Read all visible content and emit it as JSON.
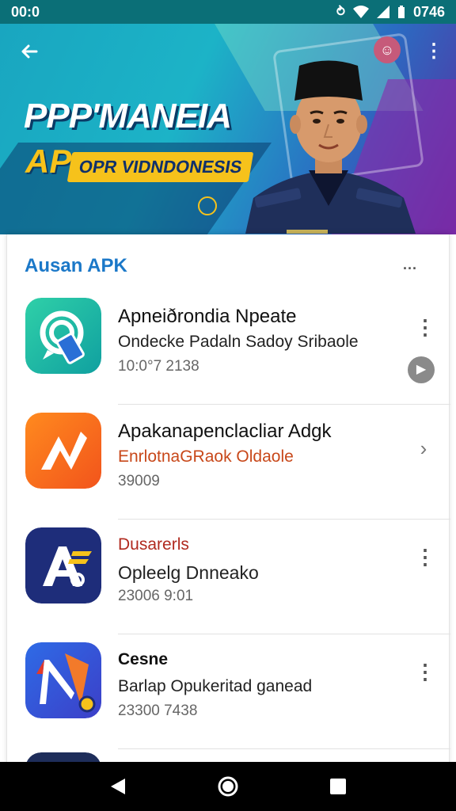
{
  "status_bar": {
    "time": "00:0",
    "right_text": "0746"
  },
  "hero": {
    "title": "PPP'MANEIA",
    "ap_label": "AP",
    "banner_text": "OPR VIDNDONESIS"
  },
  "section": {
    "title": "Ausan APK",
    "more": "..."
  },
  "apps": [
    {
      "title": "Apneiðrondia Npeate",
      "subtitle": "Ondecke Padaln Sadoy Sribaole",
      "meta": "10:0°7 2138",
      "color": "#19b39b"
    },
    {
      "title": "Apakanapenclacliar Adgk",
      "subtitle": "EnrlotnaGRaok Oldaole",
      "meta": "39009",
      "subtitle_color": "#c8481a"
    },
    {
      "title": "Dusarerls",
      "subtitle": "Opleelg Dnneako",
      "meta": "23006 9:01",
      "title_color": "#b02a1f"
    },
    {
      "title": "Cesne",
      "subtitle": "Barlap Opukeritad ganead",
      "meta": "23300 7438"
    }
  ],
  "colors": {
    "accent": "#1b78c8",
    "status_bar": "#0b6f77",
    "nav": "#000000"
  }
}
